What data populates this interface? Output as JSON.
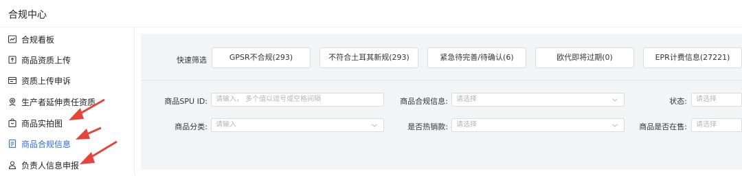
{
  "app": {
    "title": "合规中心"
  },
  "sidebar": {
    "items": [
      {
        "label": "合规看板",
        "icon": "chart-board-icon",
        "active": false
      },
      {
        "label": "商品资质上传",
        "icon": "upload-doc-icon",
        "active": false
      },
      {
        "label": "资质上传申诉",
        "icon": "appeal-icon",
        "active": false
      },
      {
        "label": "生产者延伸责任资质",
        "icon": "producer-icon",
        "active": false
      },
      {
        "label": "商品实拍图",
        "icon": "photo-bag-icon",
        "active": false
      },
      {
        "label": "商品合规信息",
        "icon": "document-icon",
        "active": true
      },
      {
        "label": "负责人信息申报",
        "icon": "person-icon",
        "active": false
      }
    ],
    "active_color": "#2d6ce0"
  },
  "quick_filter": {
    "label": "快速筛选",
    "buttons": [
      "GPSR不合规(293)",
      "不符合土耳其新规(293)",
      "紧急待完善/待确认(6)",
      "欧代即将过期(0)",
      "EPR计费信息(27221)"
    ]
  },
  "filters": {
    "spu_id": {
      "label": "商品SPU ID:",
      "placeholder": "请输入，  多个值以逗号或空格间隔"
    },
    "compliance_info": {
      "label": "商品合规信息:",
      "placeholder": "请选择"
    },
    "status": {
      "label": "状态:",
      "placeholder": "请选择"
    },
    "category": {
      "label": "商品分类:",
      "placeholder": "请输入"
    },
    "hot_sale": {
      "label": "是否热销款:",
      "placeholder": "请选择"
    },
    "on_sale": {
      "label": "商品是否在售:",
      "placeholder": "请选择"
    }
  },
  "annotation_color": "#e5443b"
}
